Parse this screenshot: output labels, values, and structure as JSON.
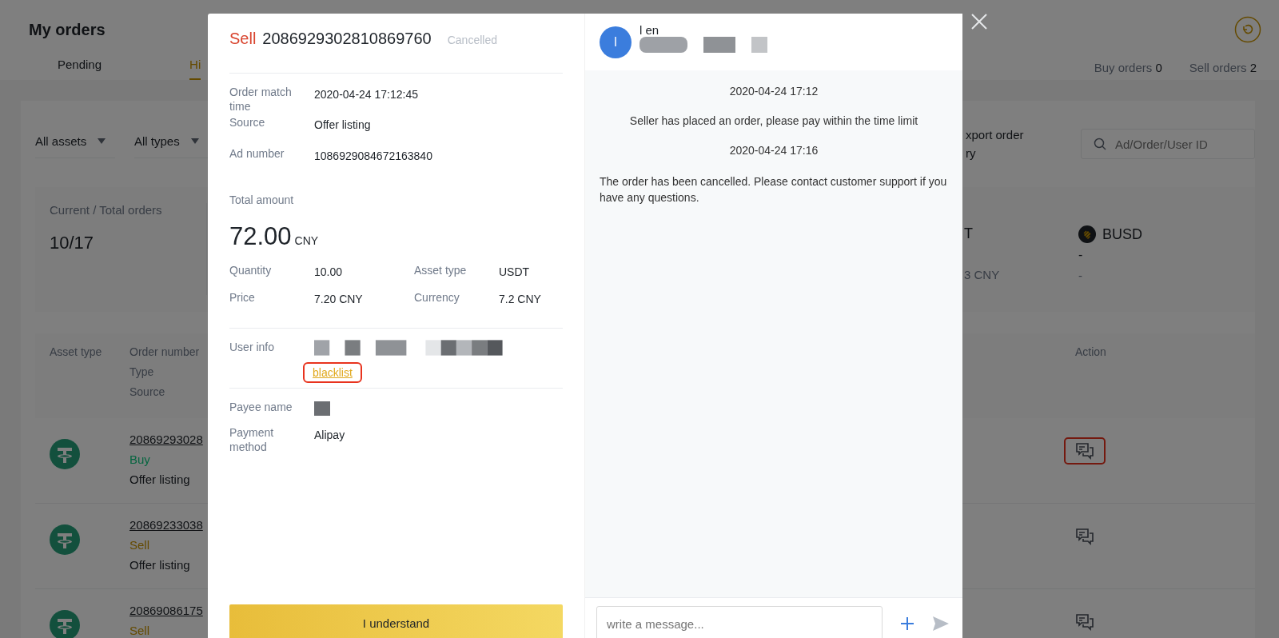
{
  "page": {
    "title": "My orders",
    "tabs": [
      {
        "label": "Pending",
        "selected": false
      },
      {
        "label": "Hi",
        "selected": true
      }
    ],
    "counts": [
      {
        "label": "Buy orders",
        "value": "0"
      },
      {
        "label": "Sell orders",
        "value": "2"
      }
    ]
  },
  "filters": [
    {
      "label": "All assets"
    },
    {
      "label": "All types"
    }
  ],
  "export_link": {
    "lines": [
      "xport order",
      "ry"
    ]
  },
  "search": {
    "placeholder": "Ad/Order/User ID"
  },
  "stats": {
    "label": "Current / Total orders",
    "value": "10/17",
    "assets": [
      {
        "name": "T",
        "kind": "plain",
        "value": "3 CNY"
      },
      {
        "name": "BUSD",
        "kind": "coin",
        "amount": "-",
        "value": "-"
      }
    ]
  },
  "table": {
    "columns": [
      {
        "lines": [
          "Asset type"
        ]
      },
      {
        "lines": [
          "Order number",
          "Type",
          "Source"
        ]
      },
      {
        "lines": [
          "Action"
        ]
      }
    ],
    "rows": [
      {
        "order_number": "20869293028",
        "type": "Buy",
        "kind": "buy",
        "source": "Offer listing",
        "highlighted": true
      },
      {
        "order_number": "20869233038",
        "type": "Sell",
        "kind": "sell",
        "source": "Offer listing",
        "highlighted": false
      },
      {
        "order_number": "20869086175",
        "type": "Sell",
        "kind": "sell",
        "highlighted": false
      }
    ]
  },
  "modal": {
    "side": "Sell",
    "order_number": "2086929302810869760",
    "status": "Cancelled",
    "details": [
      {
        "label": "Order match time",
        "value": "2020-04-24 17:12:45"
      },
      {
        "label": "Source",
        "value": "Offer listing"
      },
      {
        "label": "Ad number",
        "value": "1086929084672163840"
      }
    ],
    "total_label": "Total amount",
    "total": "72.00",
    "total_unit": "CNY",
    "grid": [
      {
        "label": "Quantity",
        "value": "10.00"
      },
      {
        "label": "Asset type",
        "value": "USDT"
      },
      {
        "label": "Price",
        "value": "7.20 CNY"
      },
      {
        "label": "Currency",
        "value": "7.2 CNY"
      }
    ],
    "user_info_label": "User info",
    "blacklist": {
      "label": "blacklist",
      "highlighted": true
    },
    "payee_label": "Payee name",
    "payment_label": "Payment method",
    "payment_value": "Alipay",
    "button": "I understand"
  },
  "chat": {
    "avatar": "l",
    "name": "l en",
    "messages": [
      {
        "kind": "time",
        "text": "2020-04-24 17:12"
      },
      {
        "kind": "notice",
        "text": "Seller has placed an order, please pay within the time limit"
      },
      {
        "kind": "time",
        "text": "2020-04-24 17:16"
      },
      {
        "kind": "message",
        "text": "The order has been cancelled. Please contact customer support if you have any questions."
      }
    ],
    "input": {
      "placeholder": "write a message..."
    }
  }
}
